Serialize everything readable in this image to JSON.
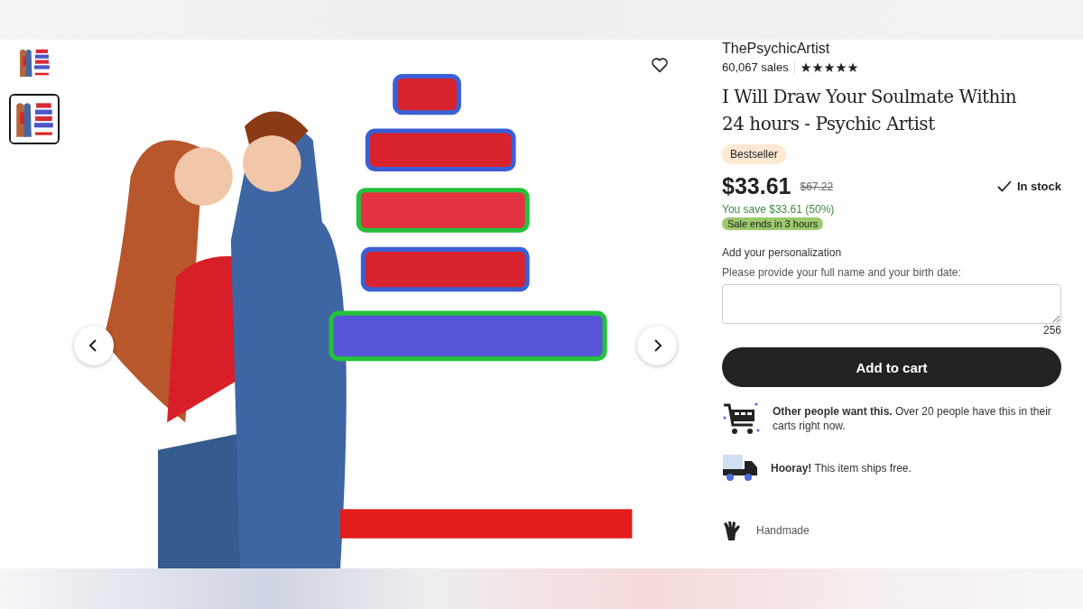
{
  "gallery": {
    "thumbnails": [
      {
        "kind": "picture",
        "selected": false
      },
      {
        "kind": "picture",
        "selected": true
      }
    ],
    "favorite": {
      "on": false
    }
  },
  "shop": {
    "name": "ThePsychicArtist",
    "sales": "60,067 sales",
    "stars": 5
  },
  "title": "I Will Draw Your Soulmate Within 24 hours - Psychic Artist",
  "badge": "Bestseller",
  "price": {
    "current": "$33.61",
    "original": "$67.22",
    "savings": "You save $33.61 (50%)",
    "sale_badge": "Sale ends in 3 hours"
  },
  "stock": "In stock",
  "personalization": {
    "heading": "Add your personalization",
    "prompt": "Please provide your full name and your birth date:",
    "counter": "256"
  },
  "add_to_cart": "Add to cart",
  "highlights": [
    {
      "kind": "cart",
      "text": "**Other people want this.** Over 20 people have this in their carts right now."
    },
    {
      "kind": "truck",
      "text": "**Hooray!** This item ships free."
    },
    {
      "kind": "hand",
      "text": "Handmade"
    }
  ]
}
